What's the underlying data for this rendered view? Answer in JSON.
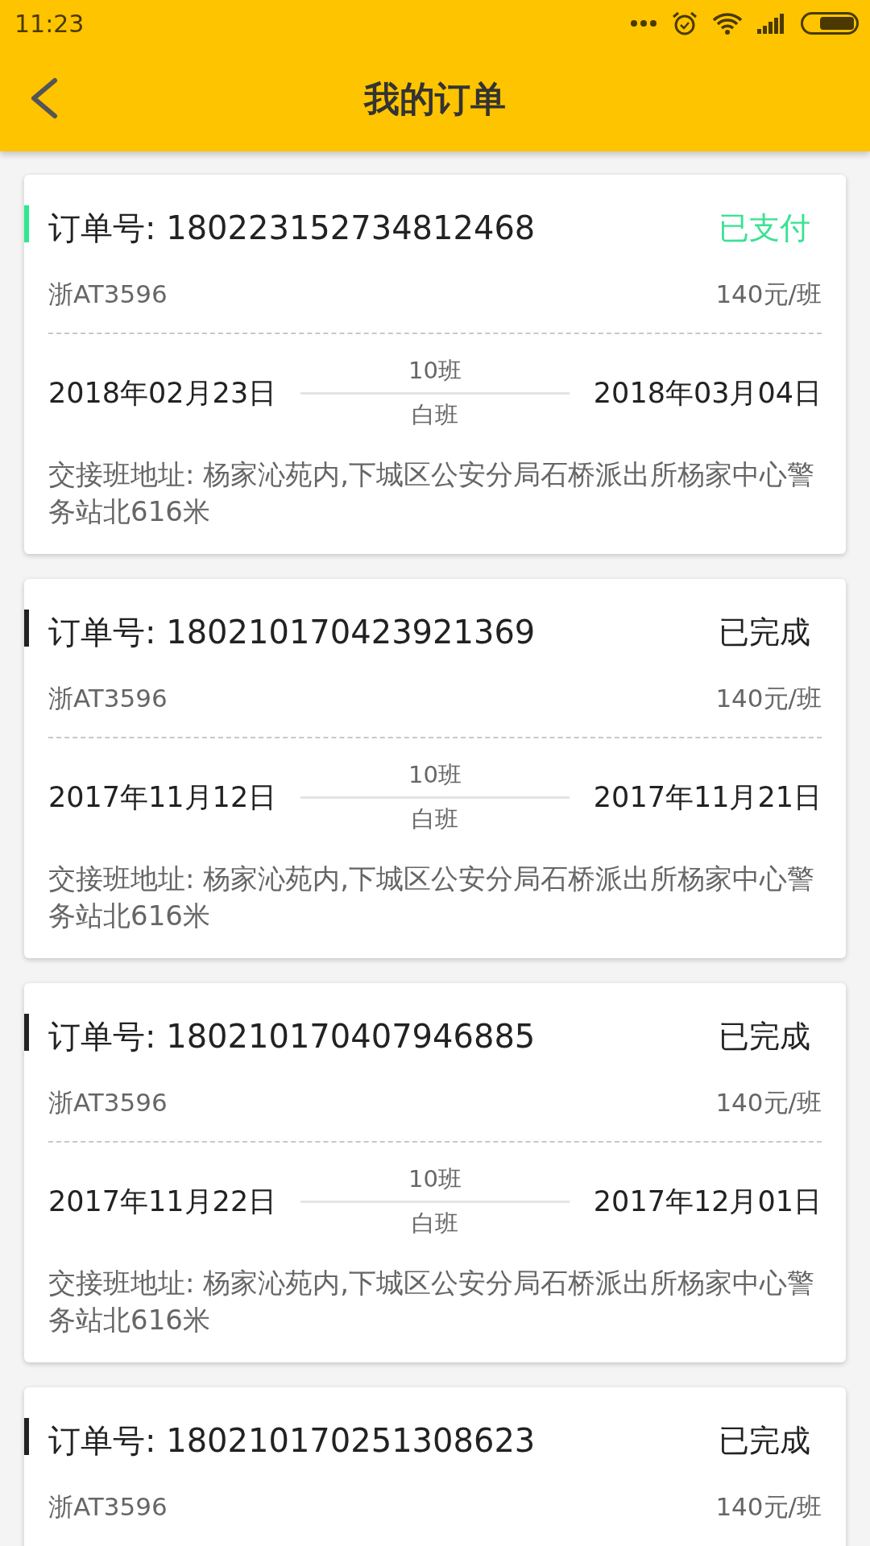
{
  "status_bar": {
    "time": "11:23"
  },
  "header": {
    "title": "我的订单"
  },
  "orders": [
    {
      "order_label": "订单号: 180223152734812468",
      "status": "已支付",
      "kind": "paid",
      "plate": "浙AT3596",
      "price": "140元/班",
      "start_date": "2018年02月23日",
      "shift_count": "10班",
      "shift_type": "白班",
      "end_date": "2018年03月04日",
      "address": "交接班地址: 杨家沁苑内,下城区公安分局石桥派出所杨家中心警务站北616米"
    },
    {
      "order_label": "订单号: 180210170423921369",
      "status": "已完成",
      "kind": "completed",
      "plate": "浙AT3596",
      "price": "140元/班",
      "start_date": "2017年11月12日",
      "shift_count": "10班",
      "shift_type": "白班",
      "end_date": "2017年11月21日",
      "address": "交接班地址: 杨家沁苑内,下城区公安分局石桥派出所杨家中心警务站北616米"
    },
    {
      "order_label": "订单号: 180210170407946885",
      "status": "已完成",
      "kind": "completed",
      "plate": "浙AT3596",
      "price": "140元/班",
      "start_date": "2017年11月22日",
      "shift_count": "10班",
      "shift_type": "白班",
      "end_date": "2017年12月01日",
      "address": "交接班地址: 杨家沁苑内,下城区公安分局石桥派出所杨家中心警务站北616米"
    },
    {
      "order_label": "订单号: 180210170251308623",
      "status": "已完成",
      "kind": "completed",
      "plate": "浙AT3596",
      "price": "140元/班"
    }
  ]
}
